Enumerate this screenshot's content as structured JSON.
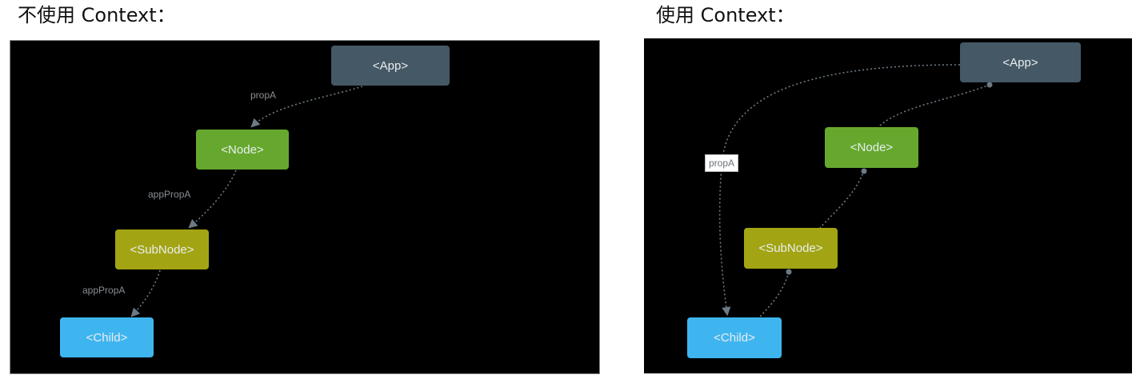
{
  "left": {
    "caption": "不使用 Context：",
    "nodes": {
      "app": {
        "label": "<App>",
        "color": "#455866"
      },
      "node": {
        "label": "<Node>",
        "color": "#66a82e"
      },
      "subnode": {
        "label": "<SubNode>",
        "color": "#a3a413"
      },
      "child": {
        "label": "<Child>",
        "color": "#3fb5f0"
      }
    },
    "edge_labels": {
      "app_node": "propA",
      "node_subnode": "appPropA",
      "subnode_child": "appPropA"
    }
  },
  "right": {
    "caption": "使用 Context：",
    "nodes": {
      "app": {
        "label": "<App>",
        "color": "#455866"
      },
      "node": {
        "label": "<Node>",
        "color": "#66a82e"
      },
      "subnode": {
        "label": "<SubNode>",
        "color": "#a3a413"
      },
      "child": {
        "label": "<Child>",
        "color": "#3fb5f0"
      }
    },
    "edge_labels": {
      "app_child": "propA"
    }
  },
  "colors": {
    "panel_background": "#000000",
    "edge": "#6d7a84"
  }
}
